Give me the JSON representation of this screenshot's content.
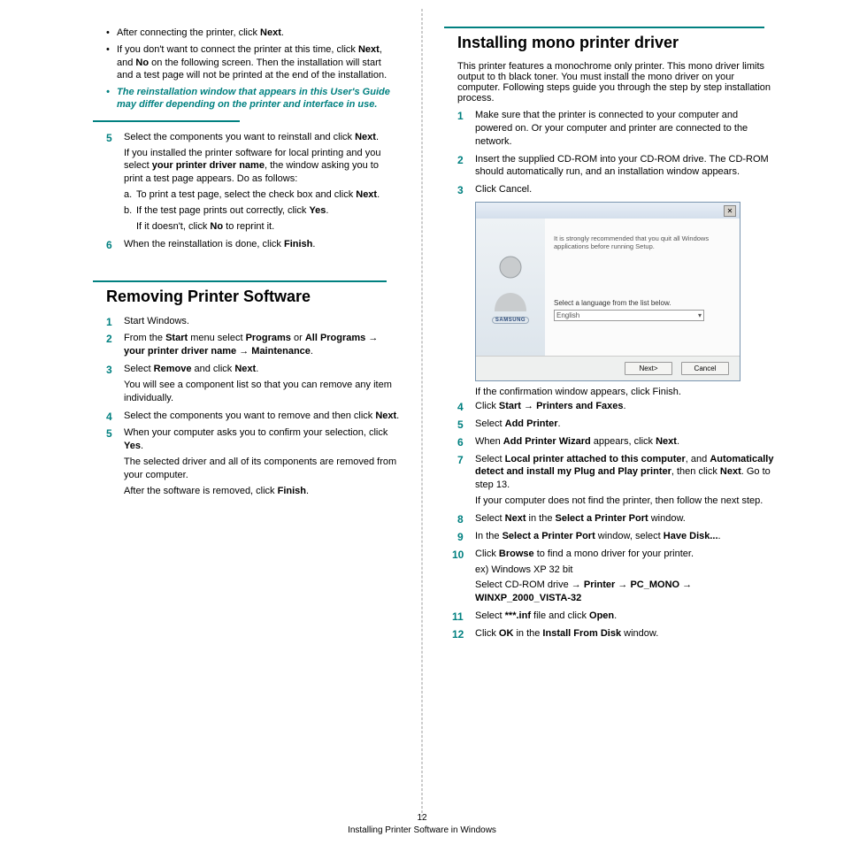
{
  "left": {
    "bullets": [
      {
        "pre": "After connecting the printer, click ",
        "b1": "Next",
        "post": "."
      },
      {
        "pre": "If you don't want to connect the printer at this time, click ",
        "b1": "Next",
        "mid": ", and ",
        "b2": "No",
        "post": " on the following screen. Then the installation will start and a test page will not be printed at the end of the installation."
      }
    ],
    "note": "The reinstallation window that appears in this User's Guide may differ depending on the printer and interface in use.",
    "step5": {
      "line1a": "Select the components you want to reinstall and click ",
      "line1b": "Next",
      "line1c": ".",
      "para_a": "If you installed the printer software for local printing and you select ",
      "para_b": "your printer driver name",
      "para_c": ", the window asking you to print a test page appears. Do as follows:",
      "sub_a_pre": "To print a test page, select the check box and click ",
      "sub_a_b": "Next",
      "sub_a_post": ".",
      "sub_b_pre": "If the test page prints out correctly, click ",
      "sub_b_b": "Yes",
      "sub_b_post": ".",
      "sub_b2_pre": "If it doesn't, click ",
      "sub_b2_b": "No",
      "sub_b2_post": " to reprint it."
    },
    "step6": {
      "pre": "When the reinstallation is done, click ",
      "b1": "Finish",
      "post": "."
    },
    "removing": {
      "title": "Removing Printer Software",
      "s1": "Start Windows.",
      "s2": {
        "pre": "From the ",
        "b1": "Start",
        "mid1": " menu select ",
        "b2": "Programs",
        "or": " or ",
        "b3": "All Programs",
        "arr1": " → ",
        "b4": "your printer driver name",
        "arr2": " → ",
        "b5": "Maintenance",
        "post": "."
      },
      "s3": {
        "pre": "Select ",
        "b1": "Remove",
        "mid": " and click ",
        "b2": "Next",
        "post": ".",
        "para": "You will see a component list so that you can remove any item individually."
      },
      "s4": {
        "pre": "Select the components you want to remove and then click ",
        "b1": "Next",
        "post": "."
      },
      "s5": {
        "pre": "When your computer asks you to confirm your selection, click ",
        "b1": "Yes",
        "post": ".",
        "para1": "The selected driver and all of its components are removed from your computer.",
        "para2a": "After the software is removed, click ",
        "para2b": "Finish",
        "para2c": "."
      }
    }
  },
  "right": {
    "title": "Installing mono printer driver",
    "intro": "This printer features a monochrome only printer. This mono driver limits output to th black toner. You must install the mono driver on your computer. Following steps guide you through the step by step installation process.",
    "s1": "Make sure that the printer is connected to your computer and powered on. Or your computer and printer are connected to the network.",
    "s2": "Insert the supplied CD-ROM into your CD-ROM drive. The CD-ROM should automatically run, and an installation window appears.",
    "s3": "Click Cancel.",
    "dialog": {
      "msg": "It is strongly recommended that you quit all Windows applications before running Setup.",
      "langlabel": "Select a language from the list below.",
      "lang": "English",
      "brand": "SAMSUNG",
      "next": "Next>",
      "cancel": "Cancel"
    },
    "after_dialog": "If the confirmation window appears, click Finish.",
    "s4": {
      "pre": "Click ",
      "b1": "Start",
      "arr": " → ",
      "b2": "Printers and Faxes",
      "post": "."
    },
    "s5": {
      "pre": "Select ",
      "b1": "Add Printer",
      "post": "."
    },
    "s6": {
      "pre": "When ",
      "b1": "Add Printer Wizard",
      "mid": " appears, click ",
      "b2": "Next",
      "post": "."
    },
    "s7": {
      "pre": "Select ",
      "b1": "Local printer attached to this computer",
      "mid1": ", and ",
      "b2": "Automatically detect and install my Plug and Play printer",
      "mid2": ", then click ",
      "b3": "Next",
      "post": ". Go to step 13.",
      "para": "If your computer does not find the printer, then follow the next step."
    },
    "s8": {
      "pre": "Select ",
      "b1": "Next",
      "mid": " in the ",
      "b2": "Select a Printer Port",
      "post": " window."
    },
    "s9": {
      "pre": "In the ",
      "b1": "Select a Printer Port",
      "mid": " window, select ",
      "b2": "Have Disk...",
      "post": "."
    },
    "s10": {
      "pre": "Click ",
      "b1": "Browse",
      "post": " to find a mono driver for your printer.",
      "ex": "ex) Windows XP 32 bit",
      "path_pre": "Select CD-ROM drive → ",
      "p1": "Printer",
      "arr1": " → ",
      "p2": "PC_MONO",
      "arr2": " → ",
      "p3": "WINXP_2000_VISTA-32"
    },
    "s11": {
      "pre": "Select ",
      "b1": "***.inf",
      "mid": " file and click ",
      "b2": "Open",
      "post": "."
    },
    "s12": {
      "pre": "Click ",
      "b1": "OK",
      "mid": " in the ",
      "b2": "Install From Disk",
      "post": " window."
    }
  },
  "footer": {
    "page": "12",
    "caption": "Installing Printer Software in Windows"
  }
}
